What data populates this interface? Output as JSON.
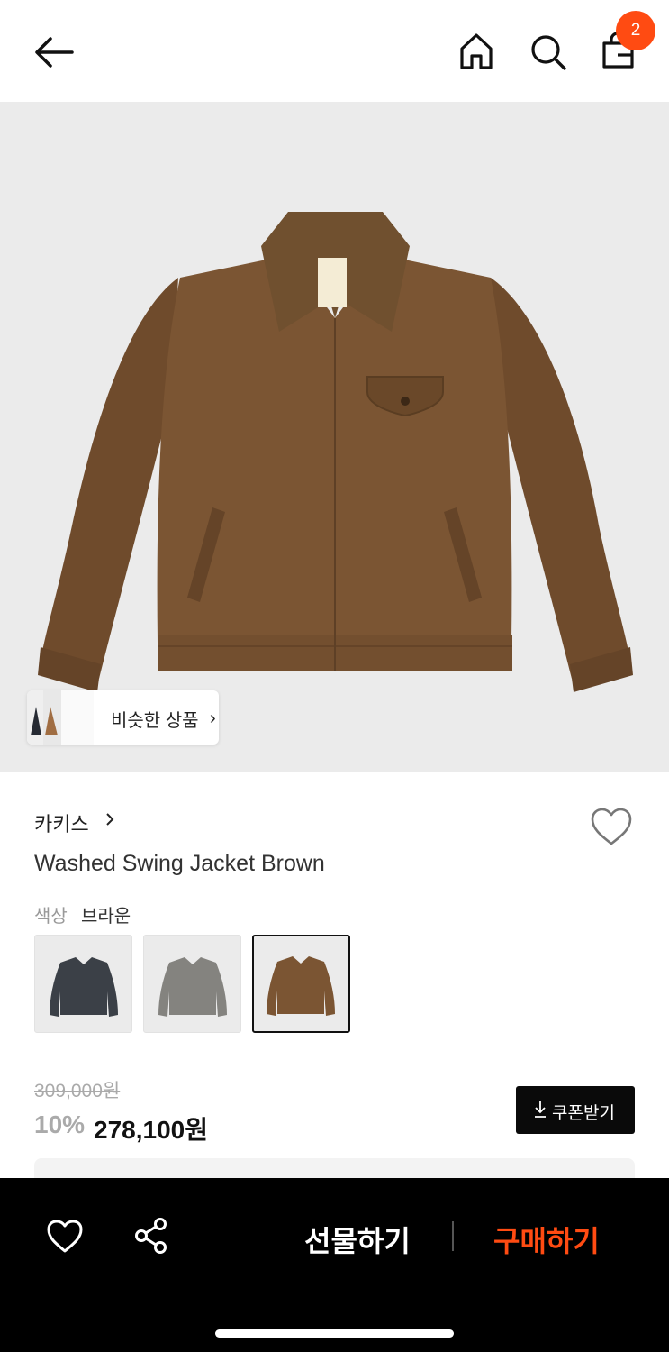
{
  "header": {
    "cart_count": "2",
    "icons": [
      "back-arrow-icon",
      "home-icon",
      "search-icon",
      "shopping-bag-icon"
    ]
  },
  "product_image": {
    "main_color": "#7b5533",
    "background": "#ebebeb"
  },
  "similar": {
    "label": "비슷한 상품"
  },
  "brand": {
    "name": "카키스"
  },
  "product": {
    "title": "Washed Swing Jacket Brown"
  },
  "color": {
    "key": "색상",
    "value": "브라운",
    "swatches": [
      {
        "color": "#3b4047",
        "selected": false
      },
      {
        "color": "#84837f",
        "selected": false
      },
      {
        "color": "#7b5533",
        "selected": true
      }
    ]
  },
  "price": {
    "original": "309,000원",
    "discount": "10%",
    "sale": "278,100원"
  },
  "coupon": {
    "label": "쿠폰받기"
  },
  "bottom_bar": {
    "gift_label": "선물하기",
    "buy_label": "구매하기",
    "accent": "#ff4b12"
  }
}
